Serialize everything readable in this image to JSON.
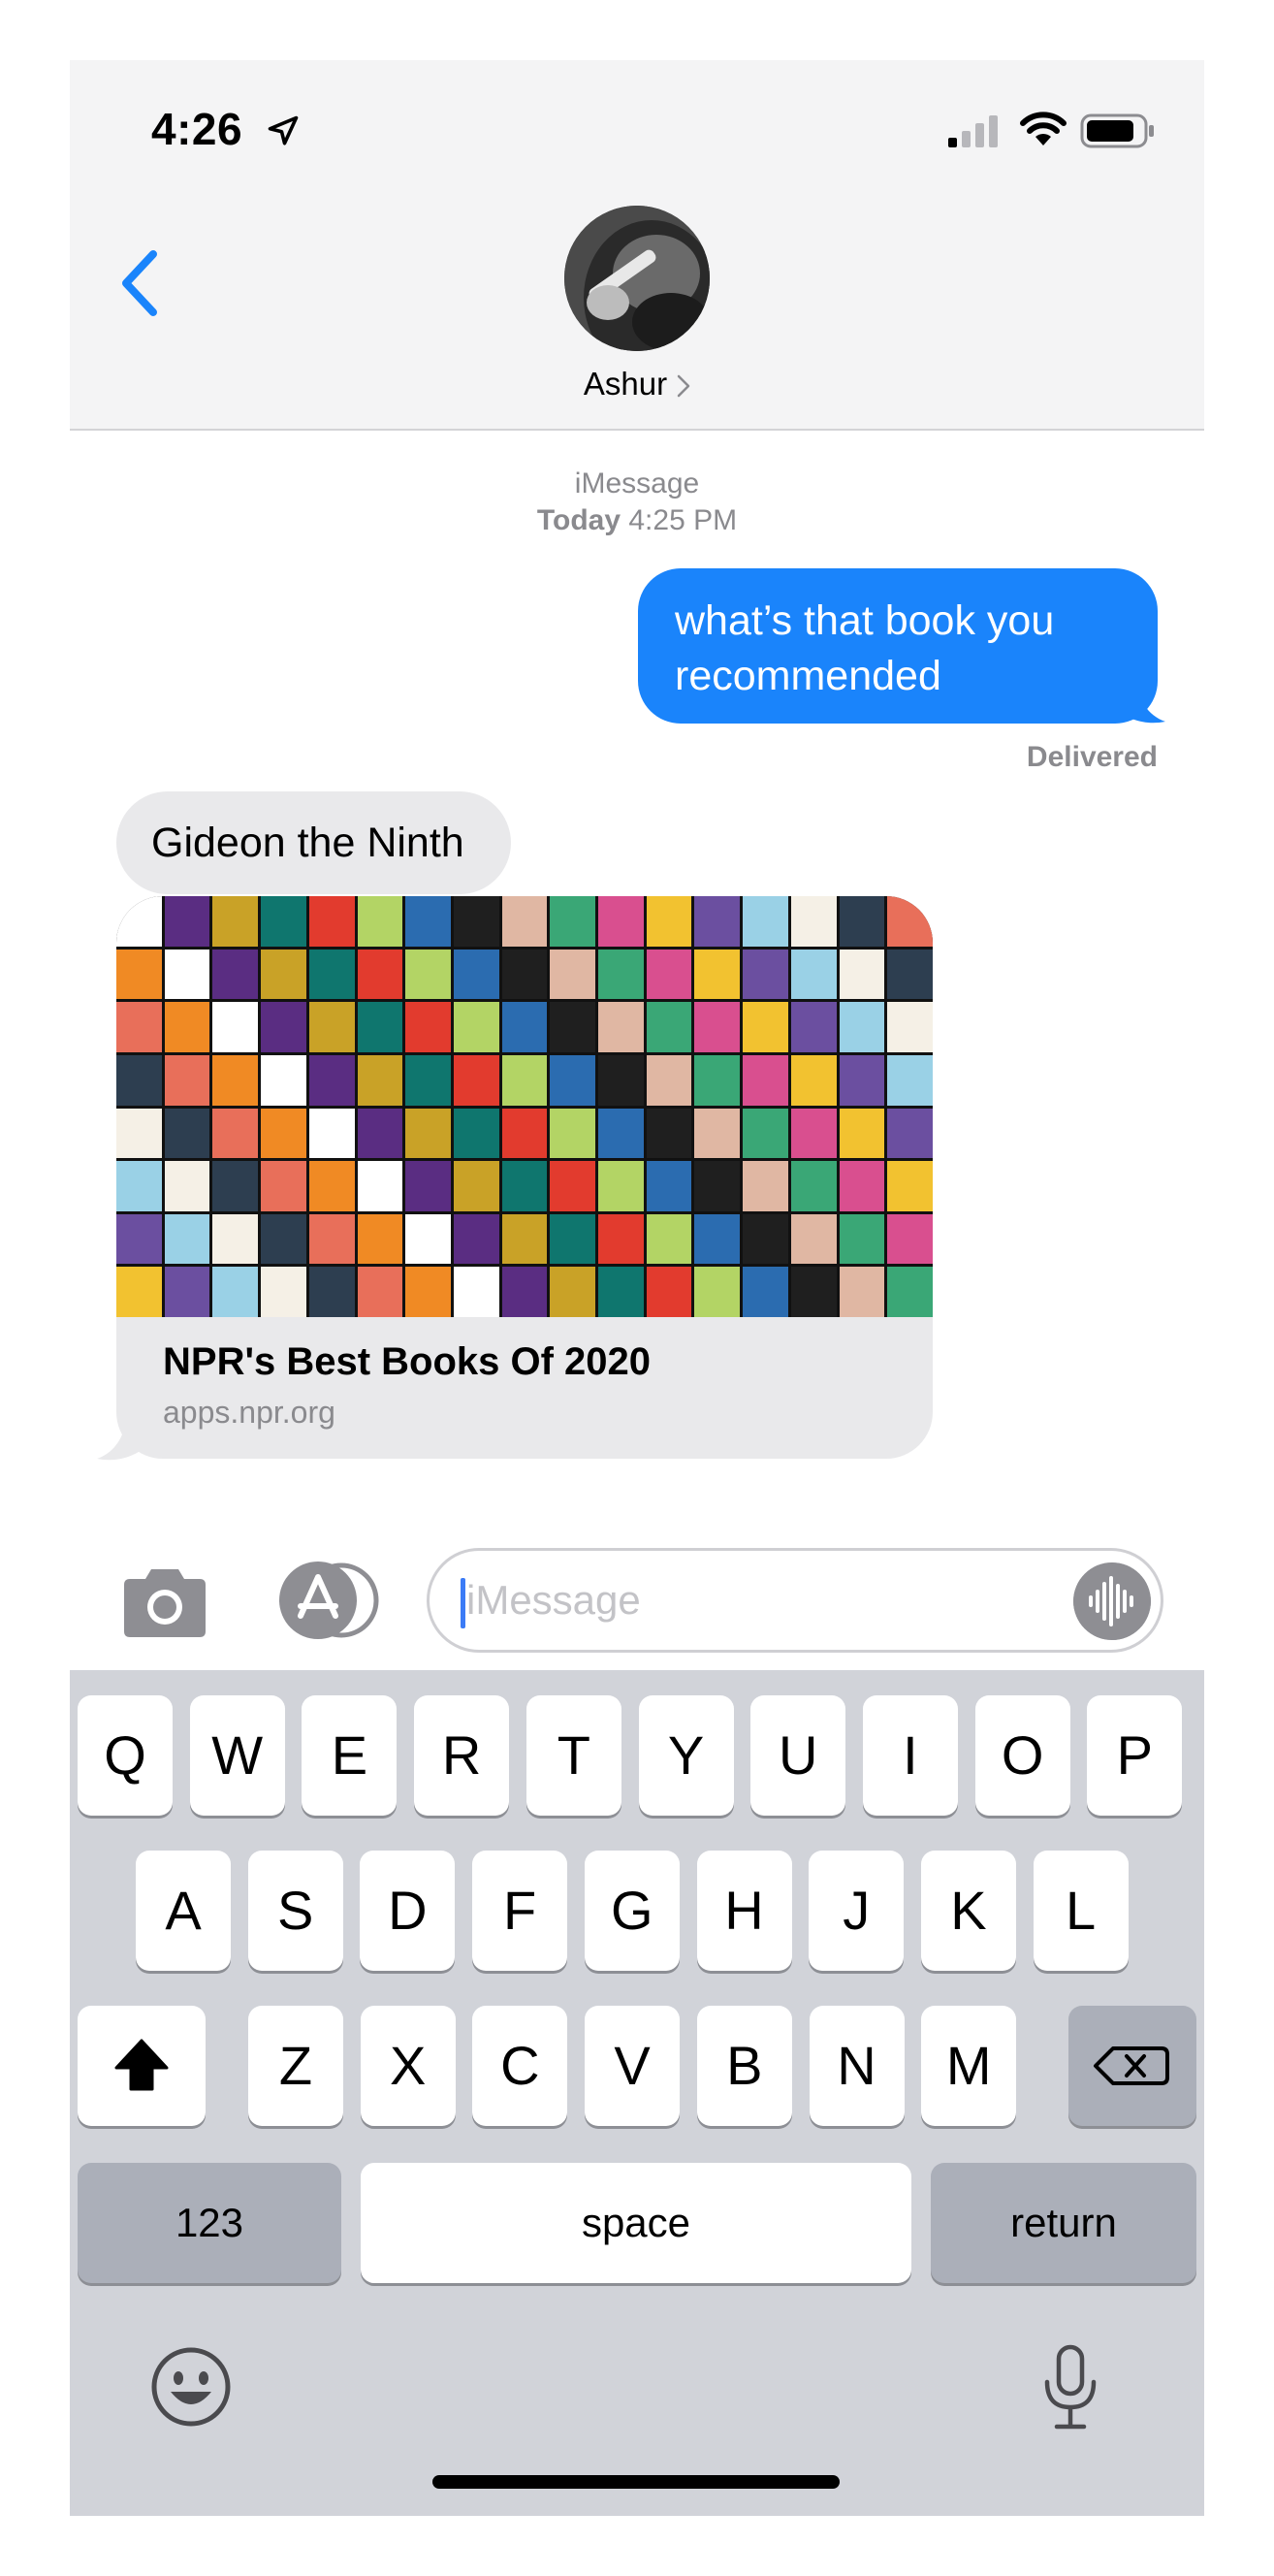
{
  "status_bar": {
    "time": "4:26",
    "icons": [
      "location-arrow-icon",
      "cellular-signal-icon",
      "wifi-icon",
      "battery-icon"
    ]
  },
  "header": {
    "back_icon": "chevron-left-icon",
    "contact_name": "Ashur",
    "accent_color": "#1a84fb"
  },
  "conversation": {
    "service": "iMessage",
    "timestamp_day": "Today",
    "timestamp_time": "4:25 PM",
    "messages": [
      {
        "direction": "outgoing",
        "text": "what’s that book you recommended",
        "status": "Delivered"
      },
      {
        "direction": "incoming",
        "text": "Gideon the Ninth"
      }
    ],
    "link_preview": {
      "title": "NPR's Best Books Of 2020",
      "domain": "apps.npr.org"
    }
  },
  "input_bar": {
    "placeholder": "iMessage",
    "icons": [
      "camera-icon",
      "app-store-icon",
      "audio-waveform-icon"
    ]
  },
  "keyboard": {
    "row1": [
      "Q",
      "W",
      "E",
      "R",
      "T",
      "Y",
      "U",
      "I",
      "O",
      "P"
    ],
    "row2": [
      "A",
      "S",
      "D",
      "F",
      "G",
      "H",
      "J",
      "K",
      "L"
    ],
    "row3": [
      "Z",
      "X",
      "C",
      "V",
      "B",
      "N",
      "M"
    ],
    "numbers_label": "123",
    "space_label": "space",
    "return_label": "return",
    "icons": [
      "shift-icon",
      "backspace-icon",
      "emoji-icon",
      "microphone-icon"
    ]
  }
}
